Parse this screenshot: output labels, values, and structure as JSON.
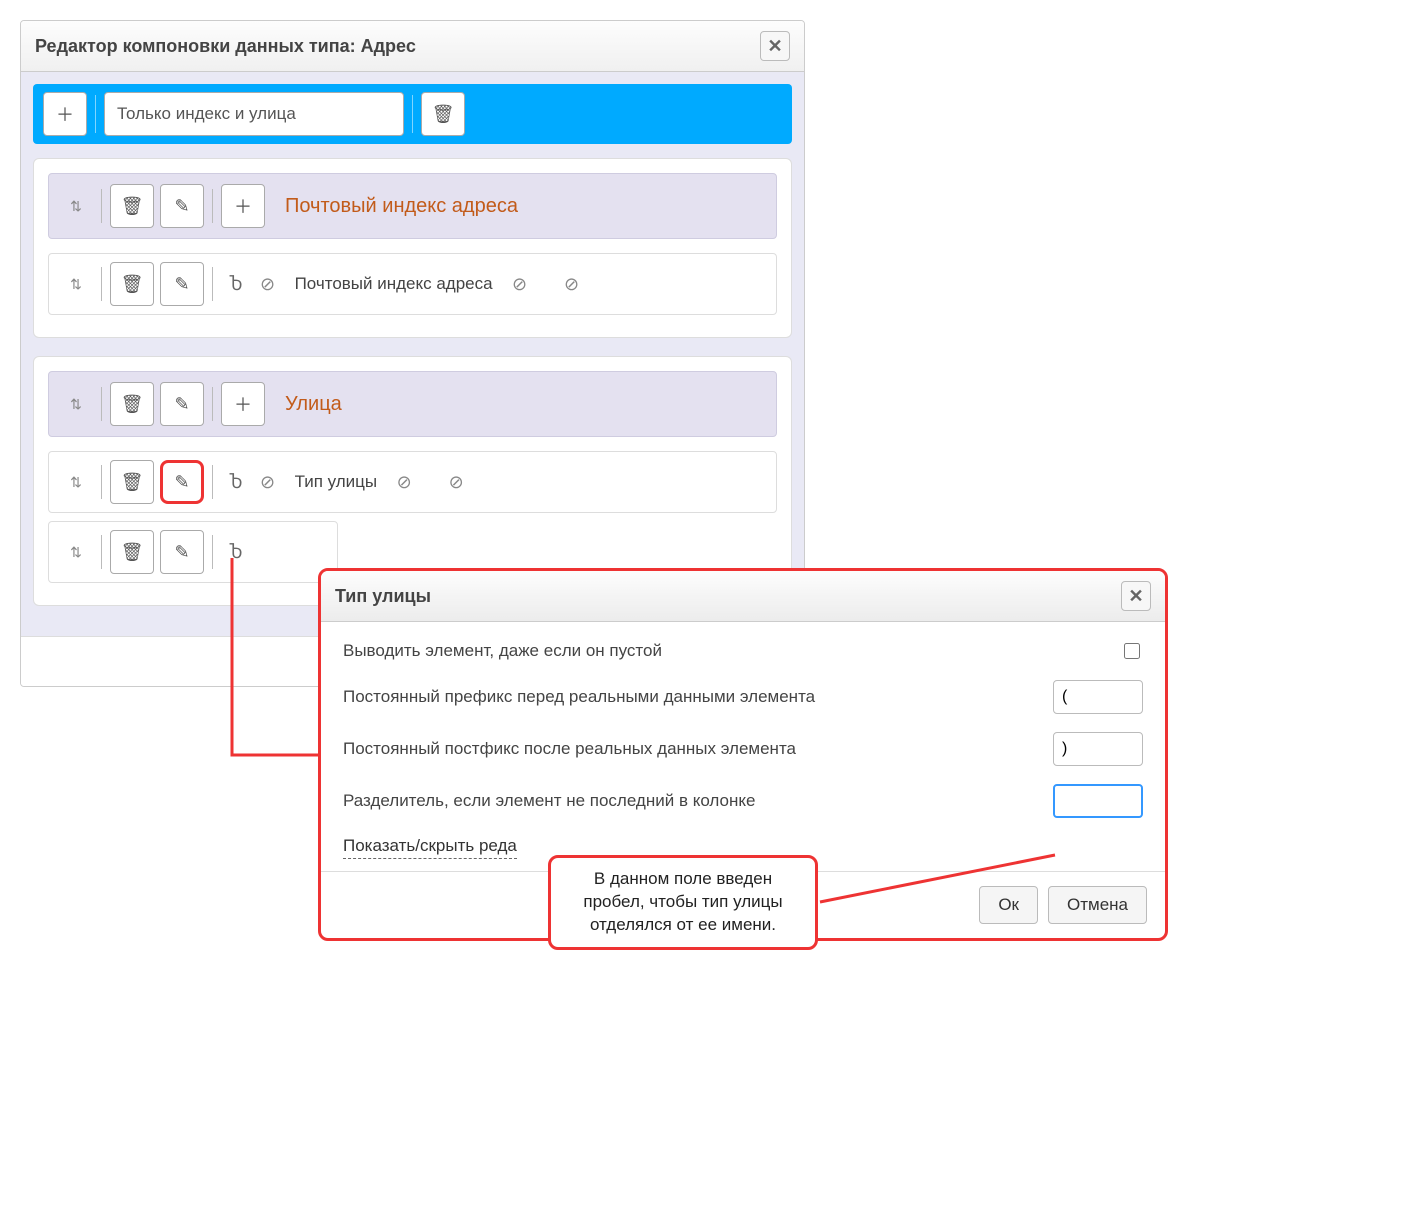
{
  "main": {
    "title": "Редактор компоновки данных типа: Адрес",
    "layout_name": "Только индекс и улица"
  },
  "groups": [
    {
      "title": "Почтовый индекс адреса",
      "items": [
        {
          "label": "Почтовый индекс адреса"
        }
      ]
    },
    {
      "title": "Улица",
      "items": [
        {
          "label": "Тип улицы",
          "highlighted_edit": true
        },
        {
          "label": ""
        }
      ]
    }
  ],
  "modal": {
    "title": "Тип улицы",
    "row_output_empty": "Выводить элемент, даже если он пустой",
    "row_prefix": "Постоянный префикс перед реальными данными элемента",
    "row_postfix": "Постоянный постфикс после реальных данных элемента",
    "row_separator": "Разделитель, если элемент не последний в колонке",
    "toggle_editor": "Показать/скрыть реда",
    "val_prefix": "(",
    "val_postfix": ")",
    "val_separator": "",
    "btn_ok": "Ок",
    "btn_cancel": "Отмена"
  },
  "callout": "В данном поле введен пробел, чтобы тип улицы отделялся от ее имени."
}
